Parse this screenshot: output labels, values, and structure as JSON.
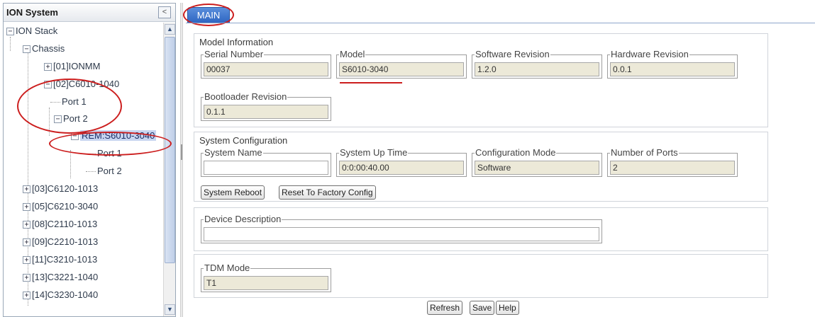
{
  "tree": {
    "title": "ION System",
    "collapse_glyph": "<",
    "nodes": {
      "ion_stack": "ION Stack",
      "chassis": "Chassis",
      "n01": "[01]IONMM",
      "n02": "[02]C6010-1040",
      "n02_port1": "Port 1",
      "n02_port2": "Port 2",
      "rem": "REM:S6010-3040",
      "rem_port1": "Port 1",
      "rem_port2": "Port 2",
      "n03": "[03]C6120-1013",
      "n05": "[05]C6210-3040",
      "n08": "[08]C2110-1013",
      "n09": "[09]C2210-1013",
      "n11": "[11]C3210-1013",
      "n13": "[13]C3221-1040",
      "n14": "[14]C3230-1040"
    },
    "expand_glyph": "+",
    "collapse_node_glyph": "−",
    "scroll_up_glyph": "▲",
    "scroll_down_glyph": "▼"
  },
  "main": {
    "tab_label": "MAIN",
    "model_info": {
      "title": "Model Information",
      "serial_label": "Serial Number",
      "serial_value": "00037",
      "model_label": "Model",
      "model_value": "S6010-3040",
      "sw_label": "Software Revision",
      "sw_value": "1.2.0",
      "hw_label": "Hardware Revision",
      "hw_value": "0.0.1",
      "boot_label": "Bootloader Revision",
      "boot_value": "0.1.1"
    },
    "sys_config": {
      "title": "System Configuration",
      "name_label": "System Name",
      "name_value": "",
      "uptime_label": "System Up Time",
      "uptime_value": "0:0:00:40.00",
      "mode_label": "Configuration Mode",
      "mode_value": "Software",
      "ports_label": "Number of Ports",
      "ports_value": "2",
      "reboot_label": "System Reboot",
      "reset_label": "Reset To Factory Config"
    },
    "device_desc": {
      "label": "Device Description",
      "value": ""
    },
    "tdm": {
      "label": "TDM Mode",
      "value": "T1"
    },
    "buttons": {
      "refresh": "Refresh",
      "save": "Save",
      "help": "Help"
    }
  },
  "colors": {
    "tab_blue": "#2f66c2",
    "selected_node": "#c8d5f0",
    "annotation_red": "#cc1e1e",
    "readonly_field": "#ece9d8"
  }
}
